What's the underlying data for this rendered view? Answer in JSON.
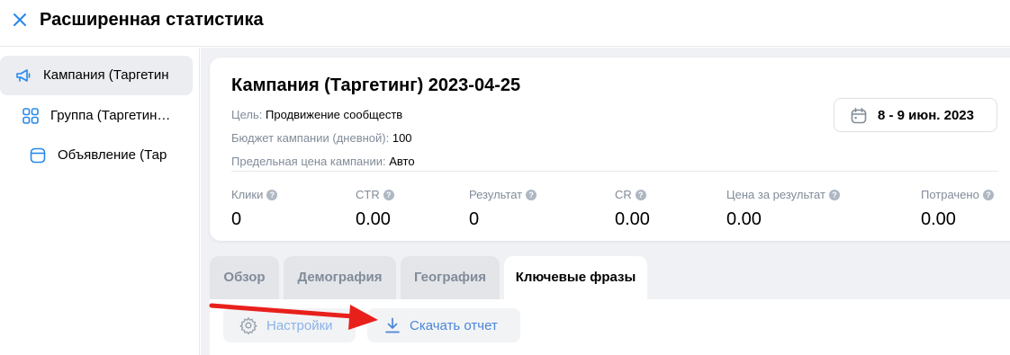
{
  "header": {
    "title": "Расширенная статистика",
    "close_icon": "close-icon"
  },
  "sidebar": {
    "items": [
      {
        "label": "Кампания (Таргетин",
        "icon": "megaphone-icon",
        "active": true
      },
      {
        "label": "Группа (Таргетин…",
        "icon": "grid-icon",
        "active": false
      },
      {
        "label": "Объявление (Тар",
        "icon": "ad-icon",
        "active": false
      }
    ]
  },
  "campaign": {
    "title": "Кампания (Таргетинг) 2023-04-25",
    "goal_label": "Цель:",
    "goal_value": "Продвижение сообществ",
    "budget_label": "Бюджет кампании (дневной):",
    "budget_value": "100",
    "limit_label": "Предельная цена кампании:",
    "limit_value": "Авто",
    "date_range": "8 - 9 июн. 2023"
  },
  "stats": [
    {
      "label": "Клики",
      "value": "0"
    },
    {
      "label": "CTR",
      "value": "0.00"
    },
    {
      "label": "Результат",
      "value": "0"
    },
    {
      "label": "CR",
      "value": "0.00"
    },
    {
      "label": "Цена за результат",
      "value": "0.00"
    },
    {
      "label": "Потрачено",
      "value": "0.00"
    }
  ],
  "tabs": [
    {
      "label": "Обзор",
      "active": false
    },
    {
      "label": "Демография",
      "active": false
    },
    {
      "label": "География",
      "active": false
    },
    {
      "label": "Ключевые фразы",
      "active": true
    }
  ],
  "toolbar": {
    "settings_label": "Настройки",
    "download_label": "Скачать отчет"
  },
  "colors": {
    "accent": "#2688eb",
    "annotation_arrow": "#e8201c"
  }
}
